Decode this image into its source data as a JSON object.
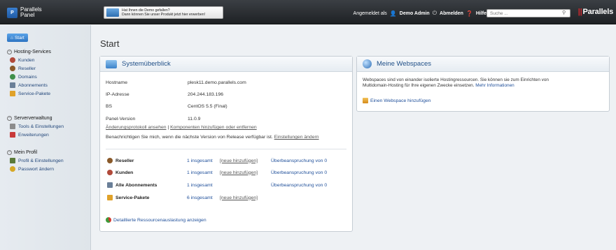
{
  "header": {
    "logo_mark": "P",
    "logo_line1": "Parallels",
    "logo_line2": "Panel",
    "promo_line1": "Hat Ihnen die Demo gefallen?",
    "promo_line2": "Dann können Sie unser Produkt jetzt hier erwerben!",
    "logged_in_label": "Angemeldet als",
    "user_name": "Demo Admin",
    "logout_label": "Abmelden",
    "help_label": "Hilfe",
    "search_placeholder": "Suche ...",
    "brand": "Parallels"
  },
  "sidebar": {
    "start_label": "Start",
    "groups": [
      {
        "title": "Hosting-Services",
        "items": [
          "Kunden",
          "Reseller",
          "Domains",
          "Abonnements",
          "Service-Pakete"
        ]
      },
      {
        "title": "Serververwaltung",
        "items": [
          "Tools & Einstellungen",
          "Erweiterungen"
        ]
      },
      {
        "title": "Mein Profil",
        "items": [
          "Profil & Einstellungen",
          "Passwort ändern"
        ]
      }
    ]
  },
  "main": {
    "title": "Start",
    "overview": {
      "title": "Systemüberblick",
      "rows": [
        {
          "label": "Hostname",
          "value": "plesk11.demo.parallels.com"
        },
        {
          "label": "IP-Adresse",
          "value": "204.244.183.196"
        },
        {
          "label": "BS",
          "value": "CentOS 5.5 (Final)"
        },
        {
          "label": "Panel-Version",
          "value": "11.0.9"
        }
      ],
      "changelog_link": "Änderungsprotokoll ansehen",
      "divider": "|",
      "components_link": "Komponenten hinzufügen oder entfernen",
      "notify_text": "Benachrichtigen Sie mich, wenn die nächste Version von Release verfügbar ist.",
      "settings_link": "Einstellungen ändern",
      "resources": [
        {
          "name": "Reseller",
          "count": "1 insgesamt",
          "add": "[neue hinzufügen]",
          "over": "Überbeanspruchung von 0"
        },
        {
          "name": "Kunden",
          "count": "1 insgesamt",
          "add": "[neue hinzufügen]",
          "over": "Überbeanspruchung von 0"
        },
        {
          "name": "Alle Abonnements",
          "count": "1 insgesamt",
          "add": "",
          "over": "Überbeanspruchung von 0"
        },
        {
          "name": "Service-Pakete",
          "count": "6 insgesamt",
          "add": "[neue hinzufügen]",
          "over": ""
        }
      ],
      "details_link": "Detaillierte Ressourcenauslastung anzeigen"
    },
    "webspaces": {
      "title": "Meine Webspaces",
      "description_line1": "Webspaces sind von einander isolierte Hostingressourcen. Sie können sie zum Einrichten von",
      "description_line2": "Multidomain-Hosting für Ihre eigenen Zwecke einsetzen.",
      "more_info_link": "Mehr Informationen",
      "add_link": "Einen Webspace hinzufügen"
    }
  },
  "colors": {
    "topbar": "#2b2e32",
    "accent_blue": "#2d74c2",
    "brand_red": "#d8262c",
    "link": "#1f4f9a"
  }
}
